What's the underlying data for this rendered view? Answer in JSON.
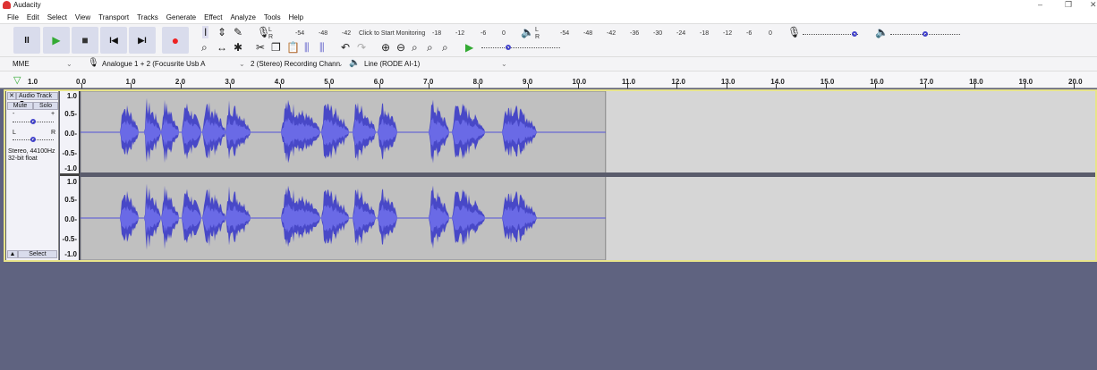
{
  "app": {
    "title": "Audacity"
  },
  "window_controls": {
    "minimize": "–",
    "maximize": "❐",
    "close": "✕"
  },
  "menu": [
    "File",
    "Edit",
    "Select",
    "View",
    "Transport",
    "Tracks",
    "Generate",
    "Effect",
    "Analyze",
    "Tools",
    "Help"
  ],
  "transport": {
    "pause": "II",
    "play": "▶",
    "stop": "■",
    "skip_start": "I◀",
    "skip_end": "▶I",
    "record": "●"
  },
  "record_meter": {
    "ticks": [
      "-54",
      "-48",
      "-42",
      "-18",
      "-12",
      "-6",
      "0"
    ],
    "prompt": "Click to Start Monitoring",
    "lr": [
      "L",
      "R"
    ]
  },
  "play_meter": {
    "ticks": [
      "-54",
      "-48",
      "-42",
      "-36",
      "-30",
      "-24",
      "-18",
      "-12",
      "-6",
      "0"
    ],
    "lr": [
      "L",
      "R"
    ]
  },
  "device": {
    "host": "MME",
    "input": "Analogue 1 + 2 (Focusrite Usb A",
    "channels": "2 (Stereo) Recording Chann",
    "output": "Line (RODE AI-1)"
  },
  "ruler": {
    "start": "1.0",
    "ticks": [
      "0.0",
      "1.0",
      "2.0",
      "3.0",
      "4.0",
      "5.0",
      "6.0",
      "7.0",
      "8.0",
      "9.0",
      "10.0",
      "11.0",
      "12.0",
      "13.0",
      "14.0",
      "15.0",
      "16.0",
      "17.0",
      "18.0",
      "19.0",
      "20.0"
    ]
  },
  "track": {
    "name": "Audio Track",
    "mute": "Mute",
    "solo": "Solo",
    "gain_minus": "-",
    "gain_plus": "+",
    "pan_l": "L",
    "pan_r": "R",
    "info1": "Stereo, 44100Hz",
    "info2": "32-bit float",
    "select": "Select",
    "scale": [
      "1.0",
      "0.5-",
      "0.0-",
      "-0.5-",
      "-1.0"
    ],
    "clip_end_seconds": 10.6
  },
  "colors": {
    "waveform": "#3232c8",
    "clip_bg": "#c0c0c0",
    "empty_bg": "#d6d6d6",
    "accent": "#e8e48a"
  }
}
